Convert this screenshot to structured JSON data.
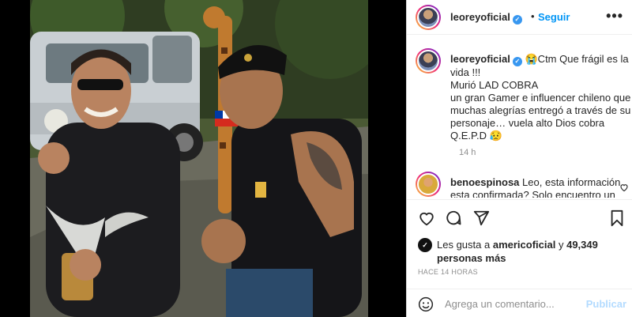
{
  "post": {
    "username": "leoreyoficial",
    "separator": "•",
    "follow_label": "Seguir",
    "more_label": "•••"
  },
  "caption": {
    "username": "leoreyoficial",
    "text": "😭Ctm Que frágil es la vida !!!\nMurió LAD COBRA\nun gran Gamer e influencer chileno que muchas alegrías entregó a través de su personaje… vuela alto Dios cobra Q.E.P.D 😥",
    "time": "14 h"
  },
  "comment": {
    "username": "benoespinosa",
    "text": "Leo, esta información esta confirmada? Solo encuentro un"
  },
  "likes": {
    "prefix": "Les gusta a",
    "liker": "americoficial",
    "joiner": "y",
    "count": "49,349 personas más"
  },
  "timestamp": "HACE 14 HORAS",
  "add_comment": {
    "placeholder": "Agrega un comentario...",
    "post_label": "Publicar"
  },
  "colors": {
    "accent": "#0095f6",
    "verified": "#3897f0",
    "muted": "#8e8e8e",
    "post_disabled": "#b3dbff"
  },
  "icons": [
    "verified-badge-icon",
    "more-options-icon",
    "heart-icon",
    "comment-icon",
    "share-icon",
    "bookmark-icon",
    "emoji-icon",
    "small-heart-icon"
  ]
}
